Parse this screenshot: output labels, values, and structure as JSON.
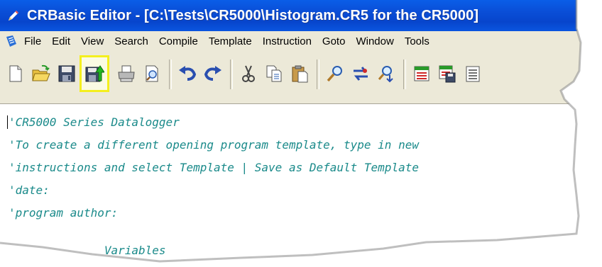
{
  "window": {
    "title": "CRBasic Editor - [C:\\Tests\\CR5000\\Histogram.CR5 for the CR5000]",
    "app_icon": "pencil-icon"
  },
  "menu": {
    "items": [
      "File",
      "Edit",
      "View",
      "Search",
      "Compile",
      "Template",
      "Instruction",
      "Goto",
      "Window",
      "Tools"
    ]
  },
  "toolbar": {
    "buttons": [
      {
        "name": "new-icon"
      },
      {
        "name": "open-icon"
      },
      {
        "name": "save-icon"
      },
      {
        "name": "compile-save-icon",
        "highlighted": true
      },
      {
        "name": "print-icon"
      },
      {
        "name": "print-preview-icon"
      },
      {
        "name": "undo-icon"
      },
      {
        "name": "redo-icon"
      },
      {
        "name": "cut-icon"
      },
      {
        "name": "copy-icon"
      },
      {
        "name": "paste-icon"
      },
      {
        "name": "find-icon"
      },
      {
        "name": "replace-icon"
      },
      {
        "name": "find-next-icon"
      },
      {
        "name": "table-icon"
      },
      {
        "name": "table-save-icon"
      },
      {
        "name": "more-icon"
      }
    ],
    "highlight_color": "#f4ef1e"
  },
  "editor": {
    "lines": [
      "'CR5000 Series Datalogger",
      "'To create a different opening program template, type in new",
      "'instructions and select Template | Save as Default Template",
      "'date:",
      "'program author:",
      "",
      "",
      "              Variables"
    ],
    "comment_color": "#1a8a8a"
  }
}
